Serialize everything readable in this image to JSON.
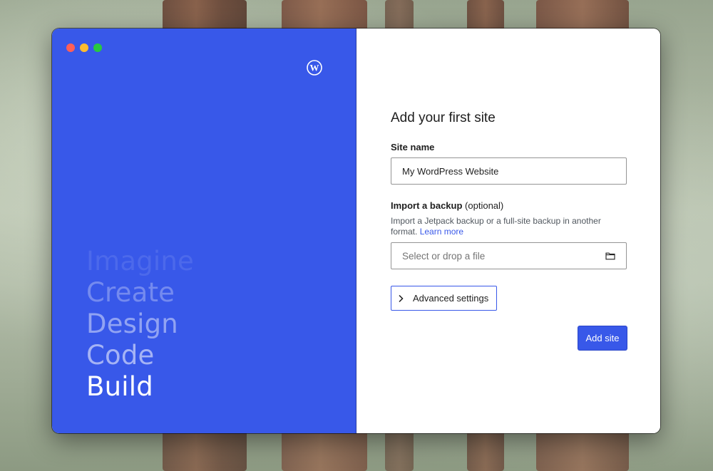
{
  "window": {
    "traffic_lights": [
      "close",
      "minimize",
      "zoom"
    ]
  },
  "left_panel": {
    "logo_icon": "wordpress-icon",
    "words": [
      "Imagine",
      "Create",
      "Design",
      "Code",
      "Build"
    ],
    "accent_color": "#3858e9"
  },
  "form": {
    "title": "Add your first site",
    "site_name_label": "Site name",
    "site_name_value": "My WordPress Website",
    "import_label": "Import a backup",
    "import_optional": "(optional)",
    "import_help": "Import a Jetpack backup or a full-site backup in another format.",
    "learn_more": "Learn more",
    "file_placeholder": "Select or drop a file",
    "file_icon": "folder-icon",
    "advanced_label": "Advanced settings",
    "advanced_icon": "chevron-right-icon",
    "submit_label": "Add site"
  }
}
